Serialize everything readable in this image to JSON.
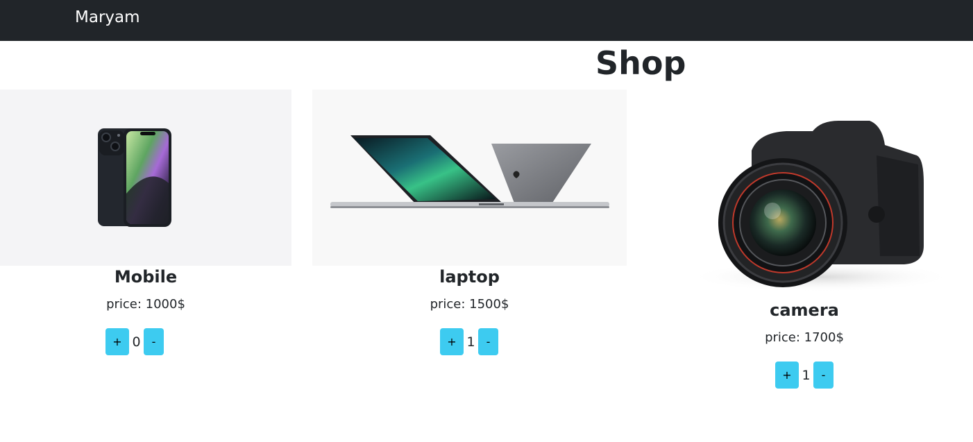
{
  "navbar": {
    "brand": "Maryam"
  },
  "page": {
    "title": "Shop"
  },
  "products": [
    {
      "name": "Mobile",
      "price": "price: 1000$",
      "count": "0",
      "image": "smartphone-image"
    },
    {
      "name": "laptop",
      "price": "price: 1500$",
      "count": "1",
      "image": "laptop-image"
    },
    {
      "name": "camera",
      "price": "price: 1700$",
      "count": "1",
      "image": "camera-image"
    }
  ],
  "buttons": {
    "plus": "+",
    "minus": "-"
  },
  "colors": {
    "navbar": "#212529",
    "button": "#3dcbf0",
    "text": "#212529"
  }
}
